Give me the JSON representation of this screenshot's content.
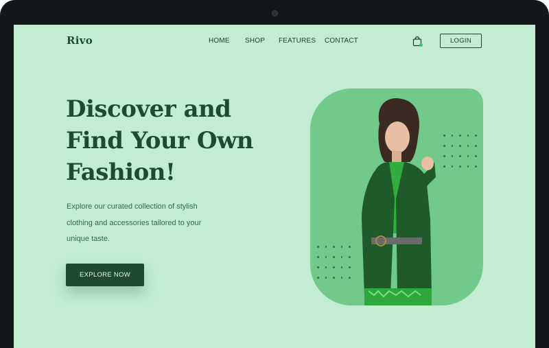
{
  "brand": {
    "logo": "Rivo"
  },
  "nav": {
    "items": [
      {
        "label": "HOME"
      },
      {
        "label": "SHOP"
      },
      {
        "label": "FEATURES"
      },
      {
        "label": "CONTACT"
      }
    ],
    "login_label": "LOGIN"
  },
  "hero": {
    "title_lines": [
      "Discover and",
      "Find Your Own",
      "Fashion!"
    ],
    "description_lines": [
      "Explore our curated collection of stylish",
      "clothing and accessories tailored to your",
      "unique taste."
    ],
    "cta_label": "EXPLORE NOW"
  },
  "colors": {
    "background": "#c3ecd3",
    "primary": "#1f4a30",
    "accent_card": "#72c98c",
    "cart_dot": "#3ec26a"
  },
  "icons": {
    "cart": "shopping-bag-icon",
    "camera": "webcam-icon"
  }
}
